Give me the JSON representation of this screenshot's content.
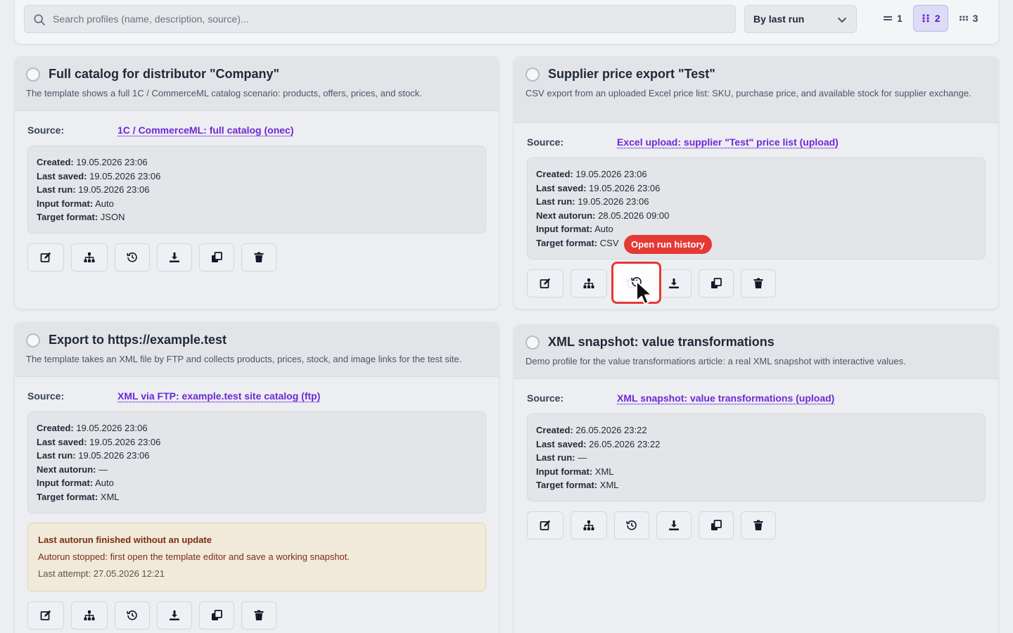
{
  "toolbar": {
    "search_placeholder": "Search profiles (name, description, source)...",
    "sort_label": "By last run",
    "columns": [
      {
        "label": "1",
        "icon": "list-icon",
        "active": false
      },
      {
        "label": "2",
        "icon": "grid-two-icon",
        "active": true
      },
      {
        "label": "3",
        "icon": "grid-three-icon",
        "active": false
      }
    ]
  },
  "cards": [
    {
      "title": "Full catalog for distributor \"Company\"",
      "description": "The template shows a full 1C / CommerceML catalog scenario: products, offers, prices, and stock.",
      "source_label": "Source:",
      "source": "1C / CommerceML: full catalog (onec)",
      "meta": [
        {
          "k": "Created:",
          "v": "19.05.2026 23:06"
        },
        {
          "k": "Last saved:",
          "v": "19.05.2026 23:06"
        },
        {
          "k": "Last run:",
          "v": "19.05.2026 23:06"
        },
        {
          "k": "Input format:",
          "v": "Auto"
        },
        {
          "k": "Target format:",
          "v": "JSON"
        }
      ]
    },
    {
      "title": "Supplier price export \"Test\"",
      "description": "CSV export from an uploaded Excel price list: SKU, purchase price, and available stock for supplier exchange.",
      "source_label": "Source:",
      "source": "Excel upload: supplier \"Test\" price list (upload)",
      "meta": [
        {
          "k": "Created:",
          "v": "19.05.2026 23:06"
        },
        {
          "k": "Last saved:",
          "v": "19.05.2026 23:06"
        },
        {
          "k": "Last run:",
          "v": "19.05.2026 23:06"
        },
        {
          "k": "Next autorun:",
          "v": "28.05.2026 09:00"
        },
        {
          "k": "Input format:",
          "v": "Auto"
        },
        {
          "k": "Target format:",
          "v": "CSV"
        }
      ]
    },
    {
      "title": "Export to https://example.test",
      "description": "The template takes an XML file by FTP and collects products, prices, stock, and image links for the test site.",
      "source_label": "Source:",
      "source": "XML via FTP: example.test site catalog (ftp)",
      "meta": [
        {
          "k": "Created:",
          "v": "19.05.2026 23:06"
        },
        {
          "k": "Last saved:",
          "v": "19.05.2026 23:06"
        },
        {
          "k": "Last run:",
          "v": "19.05.2026 23:06"
        },
        {
          "k": "Next autorun:",
          "v": "—"
        },
        {
          "k": "Input format:",
          "v": "Auto"
        },
        {
          "k": "Target format:",
          "v": "XML"
        }
      ],
      "warning": {
        "title": "Last autorun finished without an update",
        "text": "Autorun stopped: first open the template editor and save a working snapshot.",
        "attempt": "Last attempt: 27.05.2026 12:21"
      }
    },
    {
      "title": "XML snapshot: value transformations",
      "description": "Demo profile for the value transformations article: a real XML snapshot with interactive values.",
      "source_label": "Source:",
      "source": "XML snapshot: value transformations (upload)",
      "meta": [
        {
          "k": "Created:",
          "v": "26.05.2026 23:22"
        },
        {
          "k": "Last saved:",
          "v": "26.05.2026 23:22"
        },
        {
          "k": "Last run:",
          "v": "—"
        },
        {
          "k": "Input format:",
          "v": "XML"
        },
        {
          "k": "Target format:",
          "v": "XML"
        }
      ]
    }
  ],
  "actions": [
    "edit-icon",
    "sitemap-icon",
    "history-icon",
    "download-icon",
    "copy-icon",
    "trash-icon"
  ],
  "tooltip": "Open run history",
  "colors": {
    "accent": "#6d28d9",
    "tooltip": "#e53935",
    "warning_bg": "#f1eadb"
  }
}
